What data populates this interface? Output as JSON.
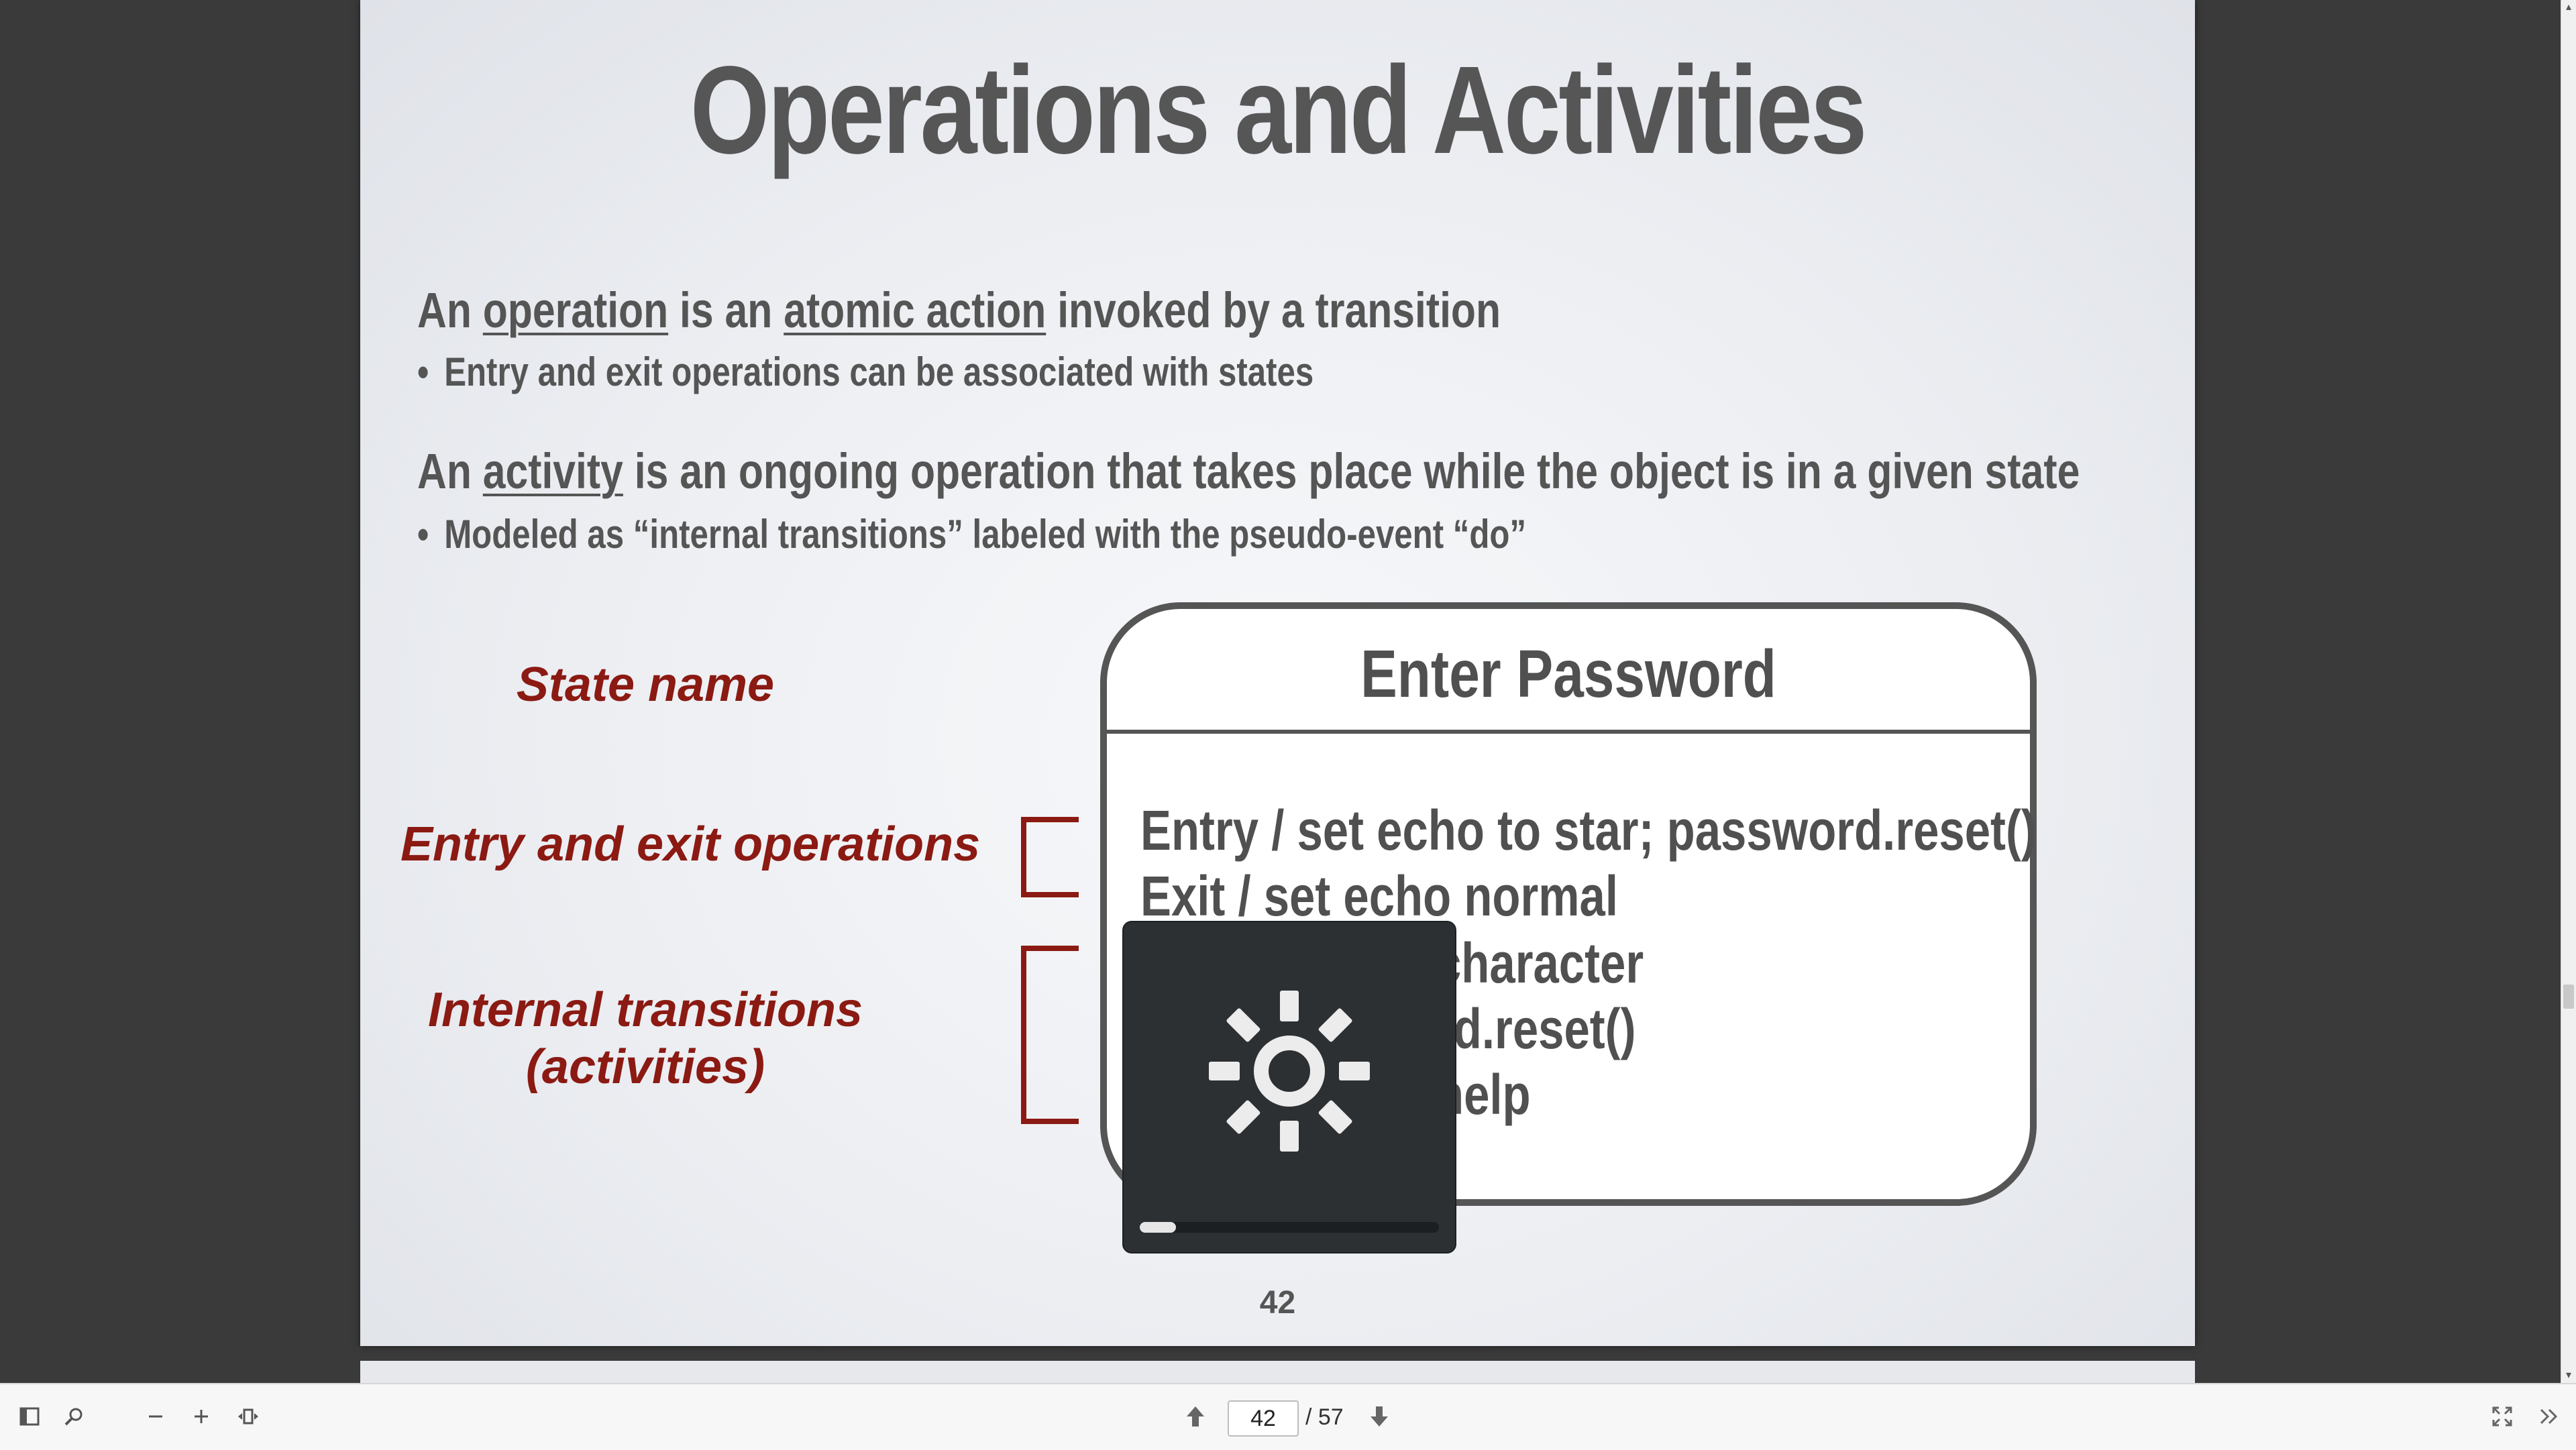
{
  "slide": {
    "title": "Operations and Activities",
    "operation_line": {
      "p1": "An ",
      "operation": "operation",
      "p2": " is an ",
      "atomic": "atomic action",
      "p3": " invoked by a transition"
    },
    "operation_bullet": "Entry and exit operations can be associated with states",
    "activity_line": {
      "p1": "An ",
      "activity": "activity",
      "p2": " is an ongoing operation that takes place while the object is in a given state"
    },
    "activity_bullet": "Modeled as “internal transitions” labeled with the pseudo-event “do”",
    "bullet_char": "•",
    "labels": {
      "state_name": "State name",
      "entry_exit": "Entry and exit operations",
      "internal_1": "Internal transitions",
      "internal_2": "(activities)"
    },
    "state": {
      "name": "Enter Password",
      "entry": "Entry / set echo to star; password.reset()",
      "exit": "Exit / set echo normal",
      "t1": "character",
      "t2": "rd.reset()",
      "t3": "help"
    },
    "page_number": "42"
  },
  "osd": {
    "icon": "brightness-icon",
    "level": 0.12
  },
  "toolbar": {
    "current_page": "42",
    "total": "/ 57",
    "icons": [
      "sidebar-toggle-icon",
      "search-icon",
      "zoom-out-icon",
      "zoom-in-icon",
      "fit-width-icon",
      "page-up-icon",
      "page-down-icon",
      "fullscreen-icon",
      "more-tools-icon"
    ]
  },
  "colors": {
    "accent_red": "#8b1a13",
    "text_gray": "#555555",
    "osd_bg": "#2c3033"
  }
}
